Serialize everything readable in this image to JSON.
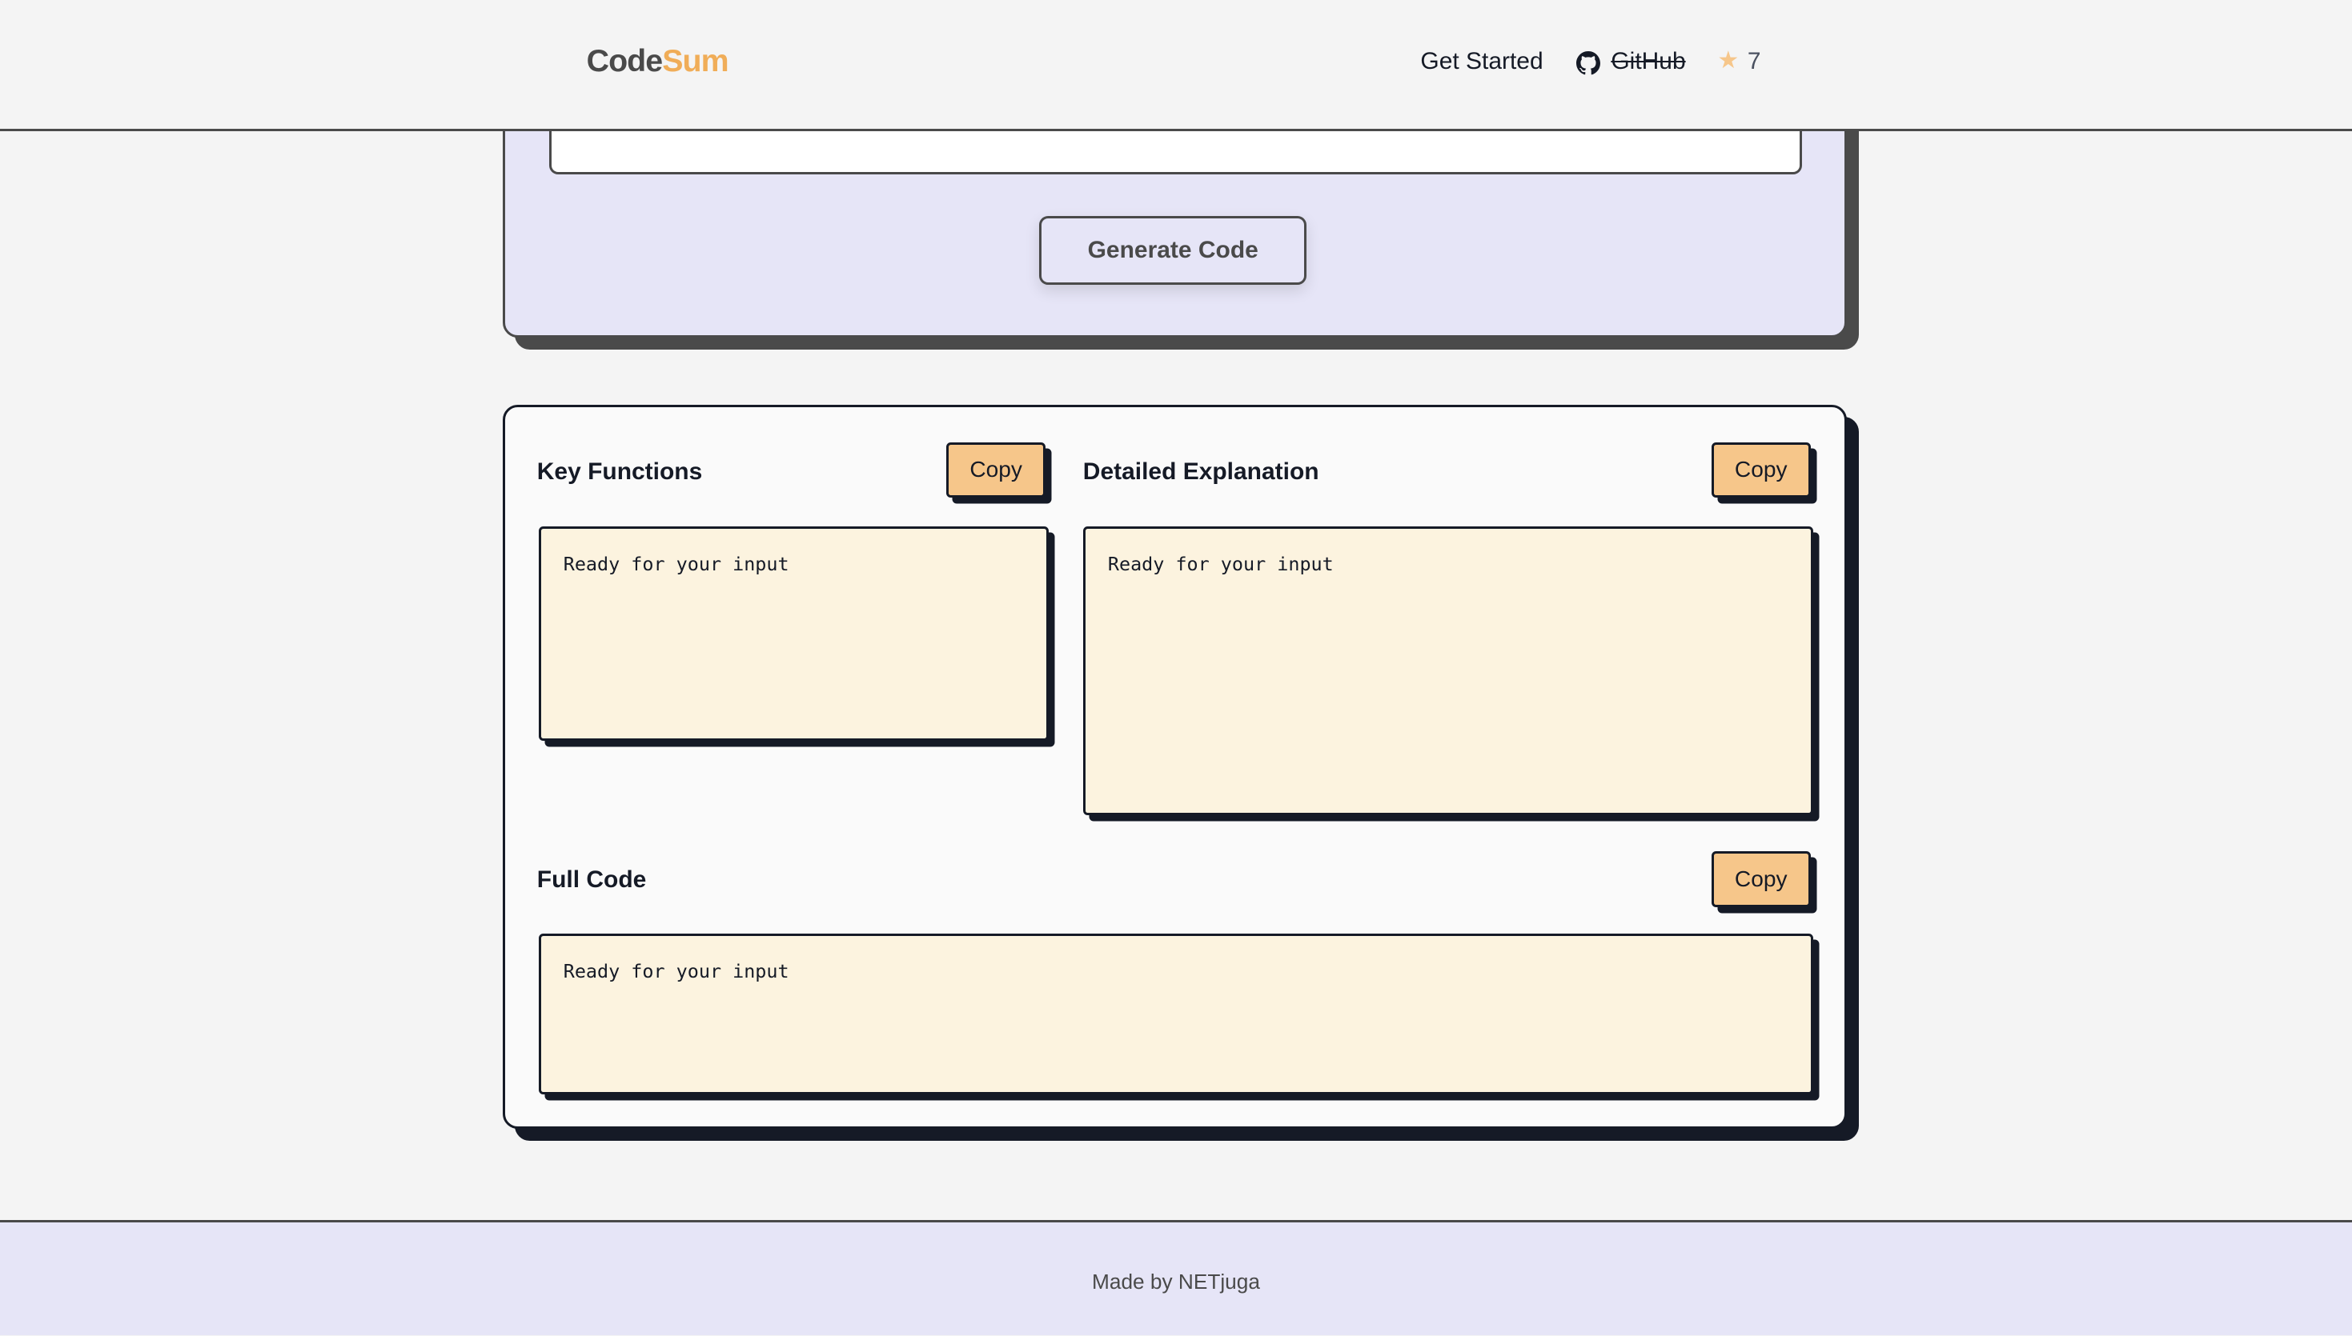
{
  "header": {
    "logo_part1": "Code",
    "logo_part2": "Sum",
    "nav_get_started": "Get Started",
    "nav_github": "GitHub",
    "star_count": "7"
  },
  "input_section": {
    "generate_label": "Generate Code"
  },
  "results": {
    "key_functions": {
      "title": "Key Functions",
      "copy_label": "Copy",
      "content": "Ready for your input"
    },
    "detailed_explanation": {
      "title": "Detailed Explanation",
      "copy_label": "Copy",
      "content": "Ready for your input"
    },
    "full_code": {
      "title": "Full Code",
      "copy_label": "Copy",
      "content": "Ready for your input"
    }
  },
  "footer": {
    "text": "Made by NETjuga"
  },
  "colors": {
    "accent": "#f0ad58",
    "copy_button": "#f6c68a",
    "lavender": "#e6e5f7",
    "output_bg": "#fcf3df",
    "dark": "#151a26"
  }
}
